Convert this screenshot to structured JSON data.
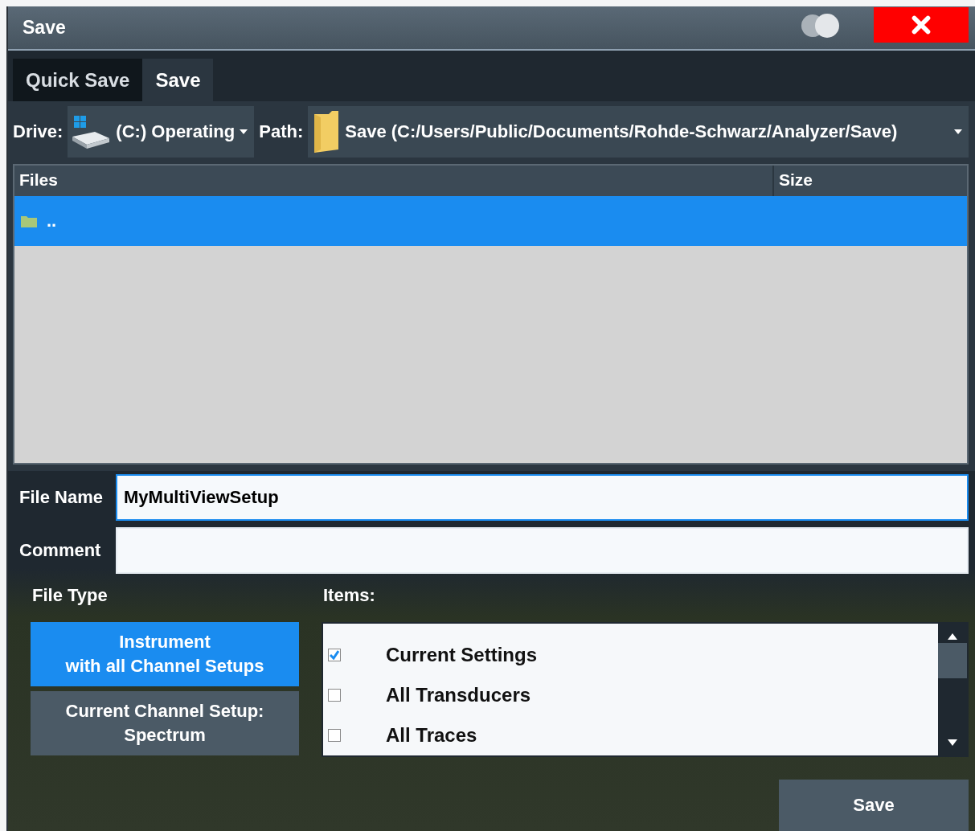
{
  "window": {
    "title": "Save"
  },
  "tabs": [
    {
      "label": "Quick Save",
      "selected": false
    },
    {
      "label": "Save",
      "selected": true
    }
  ],
  "drive": {
    "label": "Drive:",
    "value": "(C:) Operating"
  },
  "path": {
    "label": "Path:",
    "value": "Save (C:/Users/Public/Documents/Rohde-Schwarz/Analyzer/Save)"
  },
  "files": {
    "columns": [
      "Files",
      "Size"
    ],
    "rows": [
      {
        "name": "..",
        "selected": true
      }
    ]
  },
  "file_name": {
    "label": "File Name",
    "value": "MyMultiViewSetup"
  },
  "comment": {
    "label": "Comment"
  },
  "file_type": {
    "label": "File Type",
    "options": [
      {
        "lines": [
          "Instrument",
          "with all Channel Setups"
        ],
        "selected": true
      },
      {
        "lines": [
          "Current Channel Setup:",
          "Spectrum"
        ],
        "selected": false
      }
    ]
  },
  "items": {
    "label": "Items:",
    "entries": [
      {
        "label": "Current Settings",
        "checked": true
      },
      {
        "label": "All Transducers",
        "checked": false
      },
      {
        "label": "All Traces",
        "checked": false
      }
    ]
  },
  "save_button": "Save"
}
